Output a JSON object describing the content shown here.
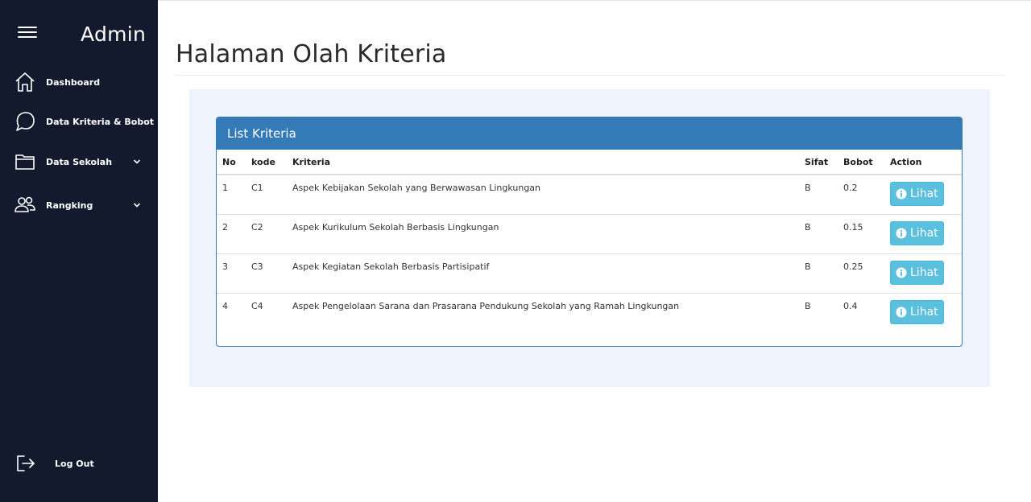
{
  "sidebar": {
    "brand": "Admin",
    "items": [
      {
        "label": "Dashboard",
        "icon": "home-icon"
      },
      {
        "label": "Data Kriteria & Bobot",
        "icon": "chat-bubble-icon"
      },
      {
        "label": "Data Sekolah",
        "icon": "folder-icon",
        "has_submenu": true
      },
      {
        "label": "Rangking",
        "icon": "users-icon",
        "has_submenu": true
      }
    ],
    "logout_label": "Log Out"
  },
  "main": {
    "page_title": "Halaman Olah Kriteria",
    "card_title": "List Kriteria",
    "table": {
      "headers": [
        "No",
        "kode",
        "Kriteria",
        "Sifat",
        "Bobot",
        "Action"
      ],
      "rows": [
        {
          "no": "1",
          "kode": "C1",
          "kriteria": "Aspek Kebijakan Sekolah yang Berwawasan Lingkungan",
          "sifat": "B",
          "bobot": "0.2",
          "action": "Lihat"
        },
        {
          "no": "2",
          "kode": "C2",
          "kriteria": "Aspek Kurikulum Sekolah Berbasis Lingkungan",
          "sifat": "B",
          "bobot": "0.15",
          "action": "Lihat"
        },
        {
          "no": "3",
          "kode": "C3",
          "kriteria": "Aspek Kegiatan Sekolah Berbasis Partisipatif",
          "sifat": "B",
          "bobot": "0.25",
          "action": "Lihat"
        },
        {
          "no": "4",
          "kode": "C4",
          "kriteria": "Aspek Pengelolaan Sarana dan Prasarana Pendukung Sekolah yang Ramah Lingkungan",
          "sifat": "B",
          "bobot": "0.4",
          "action": "Lihat"
        }
      ]
    }
  },
  "colors": {
    "sidebar_bg": "#141a2e",
    "card_header": "#337ab7",
    "button_info": "#5bc0de",
    "content_bg": "#eff3fb"
  }
}
